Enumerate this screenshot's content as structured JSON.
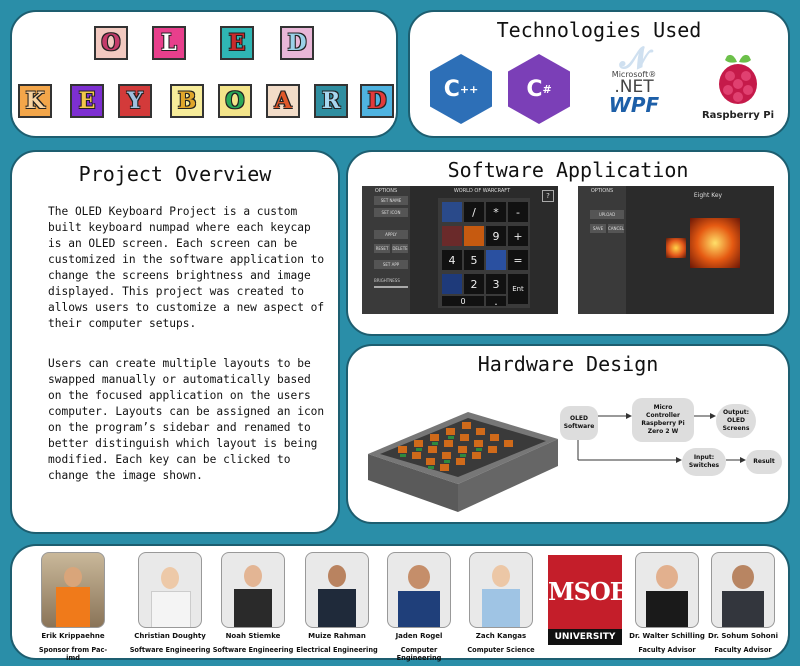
{
  "title_letters_row1": [
    "O",
    "L",
    "E",
    "D"
  ],
  "title_letters_row2": [
    "K",
    "E",
    "Y",
    "B",
    "O",
    "A",
    "R",
    "D"
  ],
  "technologies": {
    "heading": "Technologies Used",
    "logos": [
      {
        "name": "C++",
        "icon": "cpp-icon"
      },
      {
        "name": "C#",
        "icon": "csharp-icon"
      },
      {
        "name": ".NET WPF",
        "icon": "dotnet-wpf-icon",
        "text_top": "Microsoft®",
        "text_mid": ".NET",
        "text_bottom": "WPF"
      },
      {
        "name": "Raspberry Pi",
        "icon": "raspberry-pi-icon",
        "text": "Raspberry Pi"
      }
    ]
  },
  "overview": {
    "heading": "Project Overview",
    "paragraph1": "The OLED Keyboard Project is a custom built keyboard numpad where each keycap is an OLED screen. Each screen can be customized in the software application to change the screens brightness and image displayed. This project was created to allows users to customize a new aspect of their computer setups.",
    "paragraph2": "Users can create multiple layouts to be swapped manually or automatically based on the focused application on the users computer. Layouts can be assigned an icon on the program’s sidebar and renamed to better distinguish which layout is being modified. Each key can be clicked to change the image shown."
  },
  "software": {
    "heading": "Software Application",
    "screen1": {
      "options_label": "OPTIONS",
      "layout_title": "WORLD OF WARCRAFT",
      "help": "?",
      "keys": [
        "/",
        "*",
        "-",
        "9",
        "+",
        "4",
        "5",
        "=",
        "2",
        "3",
        "Ent",
        "0",
        "."
      ],
      "side_buttons": [
        "SET NAME",
        "SET ICON",
        "APPLY",
        "RESET",
        "DELETE",
        "SET APP"
      ],
      "brightness_label": "BRIGHTNESS"
    },
    "screen2": {
      "options_label": "OPTIONS",
      "key_title": "Eight Key",
      "side_buttons": [
        "UPLOAD",
        "SAVE",
        "CANCEL"
      ]
    }
  },
  "hardware": {
    "heading": "Hardware Design",
    "flow": {
      "software": "OLED Software",
      "controller": "Micro Controller Raspberry Pi Zero 2 W",
      "output": "Output: OLED Screens",
      "input": "Input: Switches",
      "result": "Result"
    }
  },
  "team": [
    {
      "name": "Erik Krippaehne",
      "role": "Sponsor from Pac-imd"
    },
    {
      "name": "Christian Doughty",
      "role": "Software Engineering"
    },
    {
      "name": "Noah Stiemke",
      "role": "Software Engineering"
    },
    {
      "name": "Muize Rahman",
      "role": "Electrical Engineering"
    },
    {
      "name": "Jaden Rogel",
      "role": "Computer Engineering"
    },
    {
      "name": "Zach Kangas",
      "role": "Computer Science"
    },
    {
      "name": "Dr. Walter Schilling",
      "role": "Faculty Advisor"
    },
    {
      "name": "Dr. Sohum Sohoni",
      "role": "Faculty Advisor"
    }
  ],
  "msoe": {
    "letters": "MSOE",
    "label": "UNIVERSITY"
  },
  "colors": {
    "background": "#2a8ea8",
    "msoe_red": "#c41e2a",
    "cpp_blue": "#2d6fb7",
    "csharp_purple": "#7b3fb7",
    "raspberry": "#c51a4a"
  }
}
